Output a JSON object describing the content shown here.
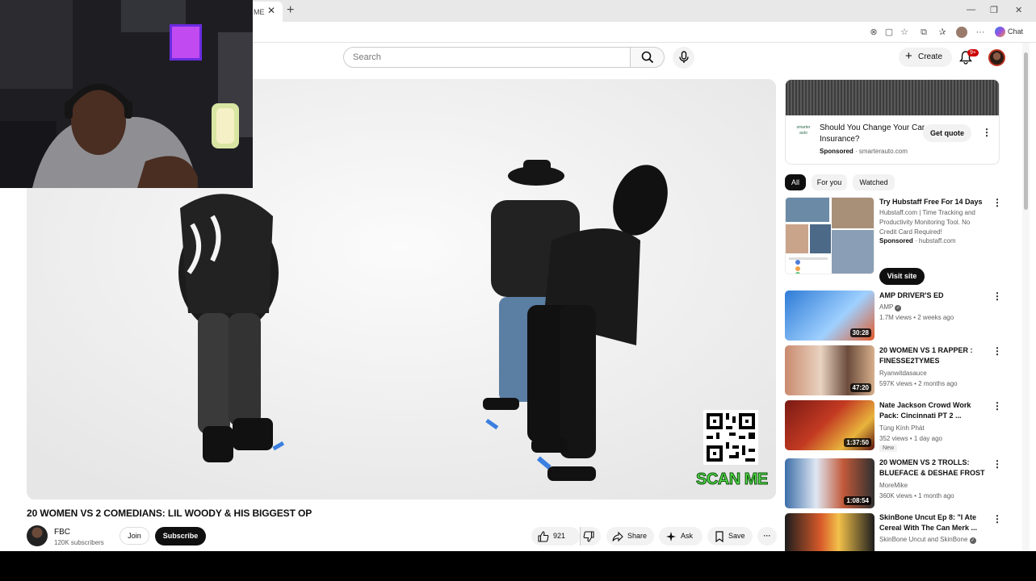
{
  "browser": {
    "tab_title": "ME",
    "chat_label": "Chat"
  },
  "header": {
    "search_placeholder": "Search",
    "create_label": "Create",
    "notification_count": "9+"
  },
  "video": {
    "title": "20 WOMEN VS 2 COMEDIANS: LIL WOODY & HIS BIGGEST OP",
    "overlay_text": "SCAN ME",
    "channel_name": "FBC",
    "subscribers": "120K subscribers",
    "join_label": "Join",
    "subscribe_label": "Subscribe",
    "likes": "921",
    "share_label": "Share",
    "ask_label": "Ask",
    "save_label": "Save"
  },
  "ad": {
    "logo_text": "smarter auto",
    "title": "Should You Change Your Car Insurance?",
    "sponsored_label": "Sponsored",
    "domain": "smarterauto.com",
    "cta_label": "Get quote"
  },
  "chips": [
    "All",
    "For you",
    "Watched"
  ],
  "recommendations": [
    {
      "title": "Try Hubstaff Free For 14 Days",
      "description": "Hubstaff.com | Time Tracking and Productivity Monitoring Tool. No Credit Card Required!",
      "sponsored_label": "Sponsored",
      "domain": "hubstaff.com",
      "cta_label": "Visit site"
    },
    {
      "title": "AMP DRIVER'S ED",
      "channel": "AMP",
      "meta": "1.7M views • 2 weeks ago",
      "duration": "30:28"
    },
    {
      "title": "20 WOMEN VS 1 RAPPER : FINESSE2TYMES",
      "channel": "Ryanwitdasauce",
      "meta": "597K views • 2 months ago",
      "duration": "47:20"
    },
    {
      "title": "Nate Jackson Crowd Work Pack: Cincinnati PT 2 ...",
      "channel": "Tùng Kính Phát",
      "meta": "352 views • 1 day ago",
      "badge": "New",
      "duration": "1:37:50"
    },
    {
      "title": "20 WOMEN VS 2 TROLLS: BLUEFACE & DESHAE FROST",
      "channel": "MoreMike",
      "meta": "360K views • 1 month ago",
      "duration": "1:08:54"
    },
    {
      "title": "SkinBone Uncut Ep 8: \"I Ate Cereal With The Can Merk ...",
      "channel": "SkinBone Uncut and SkinBone"
    }
  ]
}
